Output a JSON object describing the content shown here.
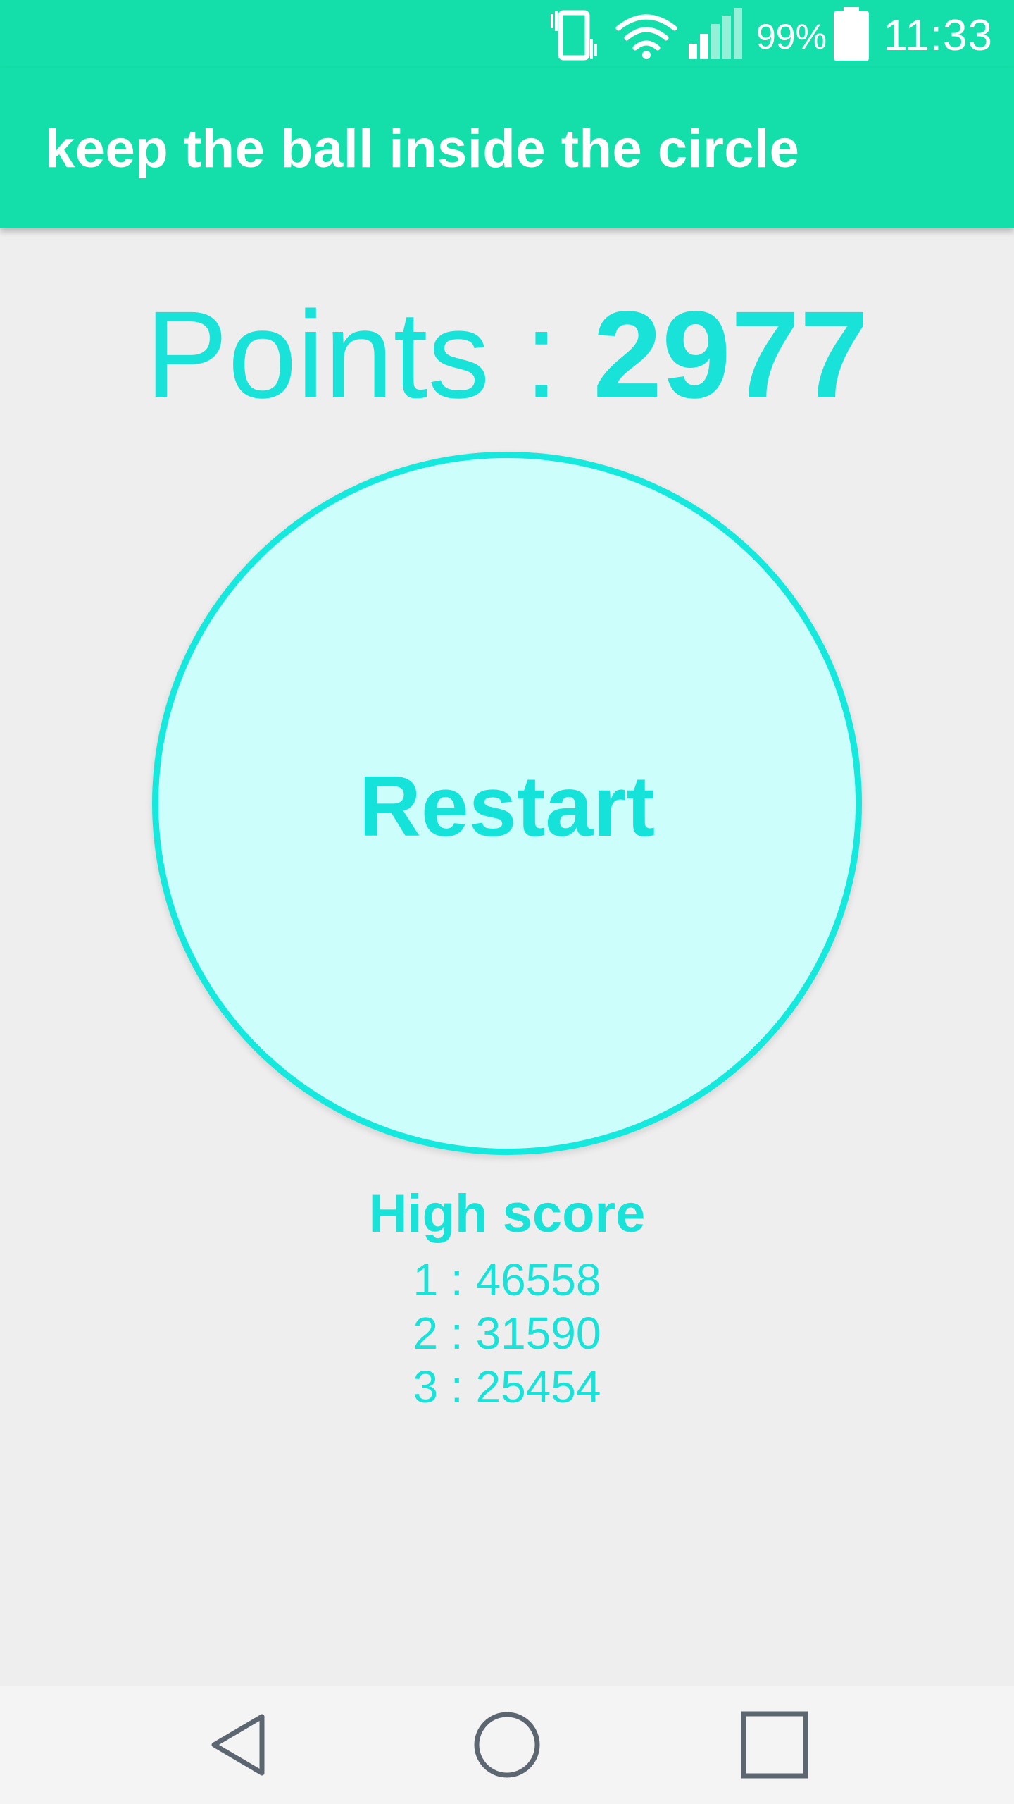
{
  "status_bar": {
    "battery_percent": "99%",
    "time": "11:33",
    "icons": [
      "vibrate-icon",
      "wifi-icon",
      "signal-icon",
      "battery-icon"
    ]
  },
  "app_bar": {
    "title": "keep the ball inside the circle"
  },
  "points": {
    "label": "Points : ",
    "value": "2977"
  },
  "restart": {
    "label": "Restart"
  },
  "high_scores": {
    "title": "High score",
    "entries": [
      "1 : 46558",
      "2 : 31590",
      "3 : 25454"
    ]
  },
  "nav_bar": {
    "icons": [
      "back-icon",
      "home-icon",
      "recents-icon"
    ]
  },
  "colors": {
    "primary": "#14dea9",
    "accent": "#19e3d8",
    "circle_fill": "#ccfefc",
    "background": "#eeeeee"
  }
}
